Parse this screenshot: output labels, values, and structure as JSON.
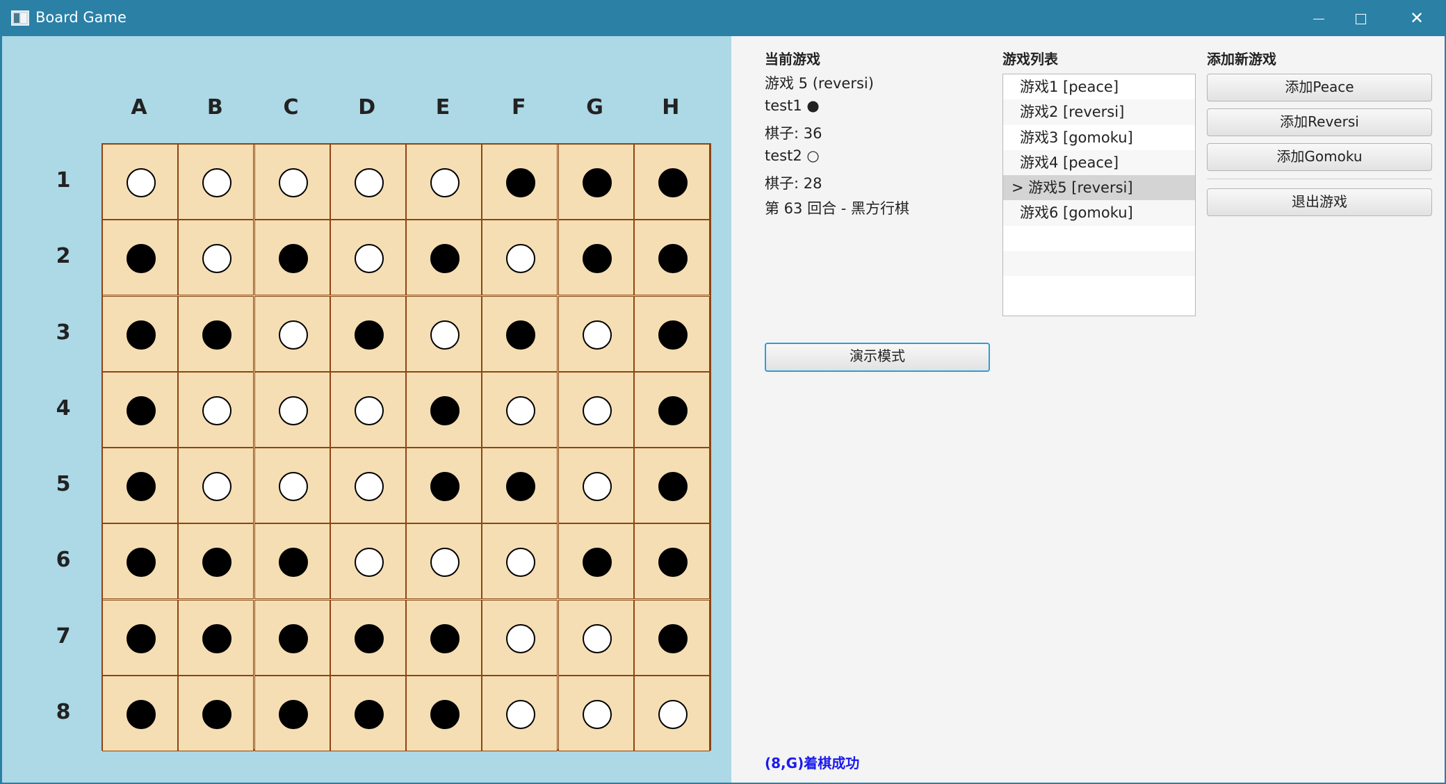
{
  "window": {
    "title": "Board Game",
    "icon": "app-board-icon"
  },
  "board": {
    "columns": [
      "A",
      "B",
      "C",
      "D",
      "E",
      "F",
      "G",
      "H"
    ],
    "rows": [
      "1",
      "2",
      "3",
      "4",
      "5",
      "6",
      "7",
      "8"
    ],
    "cells": [
      [
        "W",
        "W",
        "W",
        "W",
        "W",
        "B",
        "B",
        "B"
      ],
      [
        "B",
        "W",
        "B",
        "W",
        "B",
        "W",
        "B",
        "B"
      ],
      [
        "B",
        "B",
        "W",
        "B",
        "W",
        "B",
        "W",
        "B"
      ],
      [
        "B",
        "W",
        "W",
        "W",
        "B",
        "W",
        "W",
        "B"
      ],
      [
        "B",
        "W",
        "W",
        "W",
        "B",
        "B",
        "W",
        "B"
      ],
      [
        "B",
        "B",
        "B",
        "W",
        "W",
        "W",
        "B",
        "B"
      ],
      [
        "B",
        "B",
        "B",
        "B",
        "B",
        "W",
        "W",
        "B"
      ],
      [
        "B",
        "B",
        "B",
        "B",
        "B",
        "W",
        "W",
        "W"
      ]
    ],
    "colors": {
      "background": "#add8e6",
      "cell": "#f5deb3",
      "grid": "#8b4513"
    }
  },
  "current_game": {
    "heading": "当前游戏",
    "game_line": "游戏 5 (reversi)",
    "player1": "test1 ●",
    "player1_count": "棋子: 36",
    "player2": "test2 ○",
    "player2_count": "棋子: 28",
    "turn": "第 63 回合 - 黑方行棋"
  },
  "game_list": {
    "heading": "游戏列表",
    "items": [
      "游戏1 [peace]",
      "游戏2 [reversi]",
      "游戏3 [gomoku]",
      "游戏4 [peace]",
      "> 游戏5 [reversi]",
      "游戏6 [gomoku]",
      "",
      "",
      ""
    ],
    "selected_index": 4
  },
  "add_game": {
    "heading": "添加新游戏",
    "add_peace": "添加Peace",
    "add_reversi": "添加Reversi",
    "add_gomoku": "添加Gomoku",
    "exit": "退出游戏"
  },
  "demo_button": "演示模式",
  "status_message": "(8,G)着棋成功",
  "status_color": "#1a1aee"
}
